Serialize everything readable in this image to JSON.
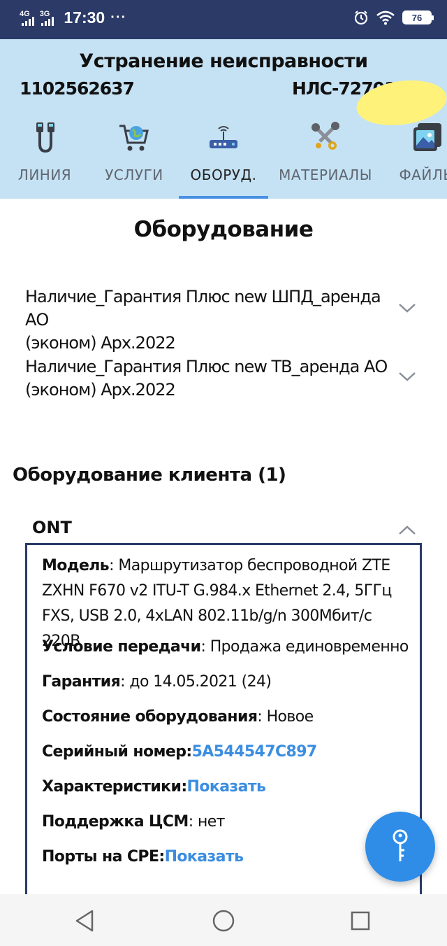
{
  "status_bar": {
    "net1": "4G",
    "net2": "3G",
    "time": "17:30",
    "dots": "···",
    "battery": "76"
  },
  "header": {
    "title": "Устранение неисправности",
    "id": "1102562637",
    "code": "НЛС-72701"
  },
  "tabs": [
    {
      "label": "ЛИНИЯ",
      "icon": "cable-icon"
    },
    {
      "label": "УСЛУГИ",
      "icon": "cart-globe-icon"
    },
    {
      "label": "ОБОРУД.",
      "icon": "router-icon",
      "active": true
    },
    {
      "label": "МАТЕРИАЛЫ",
      "icon": "bolts-icon"
    },
    {
      "label": "ФАЙЛЫ",
      "icon": "images-icon"
    }
  ],
  "main": {
    "section_title": "Оборудование",
    "accordion": [
      {
        "line1": "Наличие_Гарантия Плюс new ШПД_аренда АО",
        "line2": "(эконом) Арх.2022"
      },
      {
        "line1": "Наличие_Гарантия Плюс new ТВ_аренда АО",
        "line2": "(эконом) Арх.2022"
      }
    ],
    "client_title": "Оборудование клиента (1)",
    "device": {
      "name": "ONT",
      "model_label": "Модель",
      "model_line1": "Маршрутизатор беспроводной ZTE",
      "model_line2": "ZXHN F670 v2 ITU-T G.984.x Ethernet 2.4, 5ГГц",
      "model_line3": "FXS, USB 2.0, 4xLAN 802.11b/g/n 300Мбит/с 220В",
      "transfer_label": "Условие передачи",
      "transfer_value": "Продажа единовременно",
      "warranty_label": "Гарантия",
      "warranty_value": "до 14.05.2021 (24)",
      "condition_label": "Состояние оборудования",
      "condition_value": "Новое",
      "serial_label": "Серийный номер:",
      "serial_value": "5A544547C897",
      "specs_label": "Характеристики:",
      "specs_link": "Показать",
      "csm_label": "Поддержка ЦСМ",
      "csm_value": "нет",
      "ports_label": "Порты на CPE:",
      "ports_link": "Показать"
    }
  },
  "colors": {
    "status_bar": "#2b3a67",
    "header_bg": "#c5e2f4",
    "accent": "#4a90e2",
    "link": "#3b8de0",
    "fab": "#2f8de8",
    "redaction": "#fff27a"
  }
}
